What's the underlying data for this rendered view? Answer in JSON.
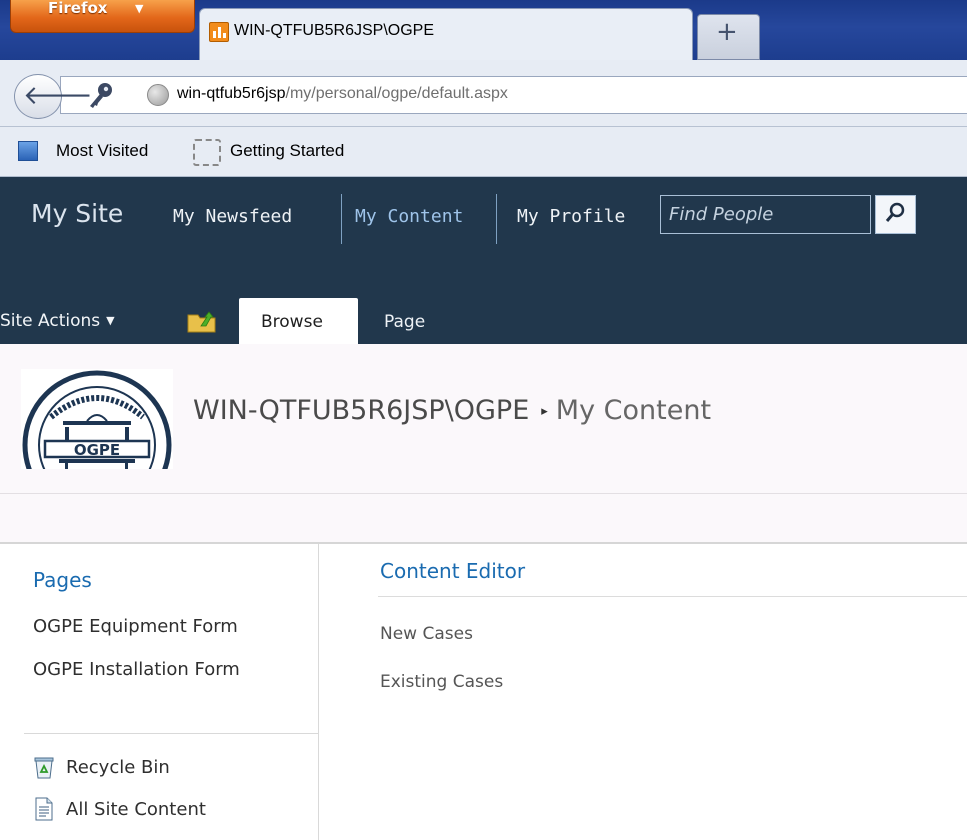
{
  "browser": {
    "app_button": "Firefox",
    "tab_title": "WIN-QTFUB5R6JSP\\OGPE",
    "new_tab": "+",
    "url_host": "win-qtfub5r6jsp",
    "url_path": "/my/personal/ogpe/default.aspx",
    "bookmarks": [
      {
        "label": "Most Visited",
        "icon": "bookmarks-folder-icon"
      },
      {
        "label": "Getting Started",
        "icon": "empty-page-icon"
      }
    ]
  },
  "sharepoint": {
    "site_title": "My Site",
    "top_nav": [
      "My Newsfeed",
      "My Content",
      "My Profile"
    ],
    "selected_nav": "My Content",
    "search_placeholder": "Find People",
    "site_actions": "Site Actions",
    "ribbon_tabs": [
      "Browse",
      "Page"
    ],
    "active_ribbon_tab": "Browse",
    "breadcrumb": {
      "site": "WIN-QTFUB5R6JSP\\OGPE",
      "separator": "▸",
      "current": "My Content"
    },
    "logo_text": "OGPE",
    "left_nav": {
      "heading": "Pages",
      "items": [
        "OGPE Equipment Form",
        "OGPE Installation Form"
      ],
      "tools": [
        {
          "label": "Recycle Bin",
          "icon": "recycle-bin-icon"
        },
        {
          "label": "All Site Content",
          "icon": "document-icon"
        }
      ]
    },
    "content_editor": {
      "title": "Content Editor",
      "links": [
        "New Cases",
        "Existing Cases"
      ]
    }
  },
  "colors": {
    "suite_bar": "#21374c",
    "link_blue": "#1a6bb0",
    "firefox_orange": "#e3671a"
  }
}
